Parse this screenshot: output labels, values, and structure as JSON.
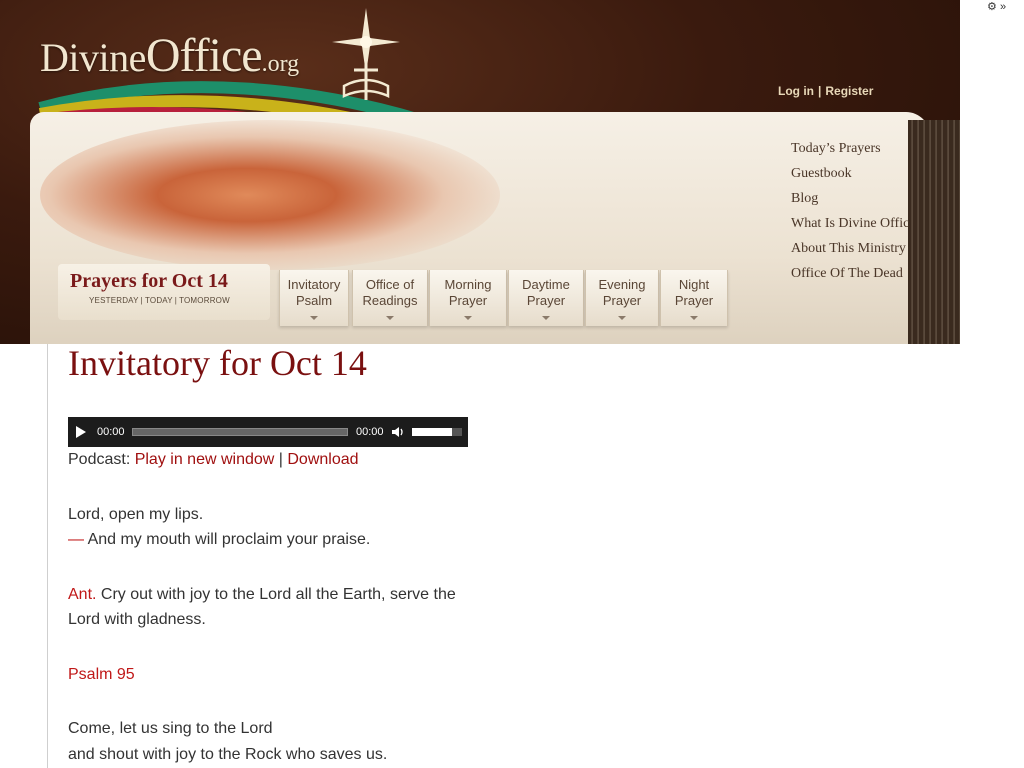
{
  "header": {
    "logo": {
      "part1": "Divine",
      "part2": "Office",
      "part3": ".org"
    },
    "auth": {
      "login": "Log in",
      "separator": "|",
      "register": "Register"
    },
    "prayers_title": "Prayers for Oct 14",
    "date_links": {
      "yesterday": "YESTERDAY",
      "today": "TODAY",
      "tomorrow": "TOMORROW",
      "separator": "|"
    },
    "tabs": [
      {
        "label": "Invitatory\nPsalm"
      },
      {
        "label": "Office of\nReadings"
      },
      {
        "label": "Morning\nPrayer"
      },
      {
        "label": "Daytime\nPrayer"
      },
      {
        "label": "Evening\nPrayer"
      },
      {
        "label": "Night\nPrayer"
      }
    ],
    "side_nav": [
      "Today’s Prayers",
      "Guestbook",
      "Blog",
      "What Is Divine Office",
      "About This Ministry",
      "Office Of The Dead"
    ],
    "ribbon_colors": [
      "#1d8f6a",
      "#c9b21a",
      "#b8203c",
      "#1f7a2a",
      "#39b8b0"
    ]
  },
  "topright_icons": [
    "settings-icon",
    "chevron-right-icon"
  ],
  "main": {
    "title": "Invitatory for Oct 14",
    "player": {
      "current_time": "00:00",
      "duration": "00:00",
      "progress": 0,
      "volume": 0.8
    },
    "podcast": {
      "label": "Podcast: ",
      "play_link": "Play in new window",
      "separator": " | ",
      "download_link": "Download"
    },
    "verse1_line1": "Lord, open my lips.",
    "verse1_dash": "—",
    "verse1_line2": " And my mouth will proclaim your praise.",
    "ant_label": "Ant.",
    "ant_line1": " Cry out with joy to the Lord all the Earth, serve the",
    "ant_line2": "Lord with gladness.",
    "psalm_heading": "Psalm 95",
    "psalm_line1": "Come, let us sing to the Lord",
    "psalm_line2": "and shout with joy to the Rock who saves us."
  }
}
